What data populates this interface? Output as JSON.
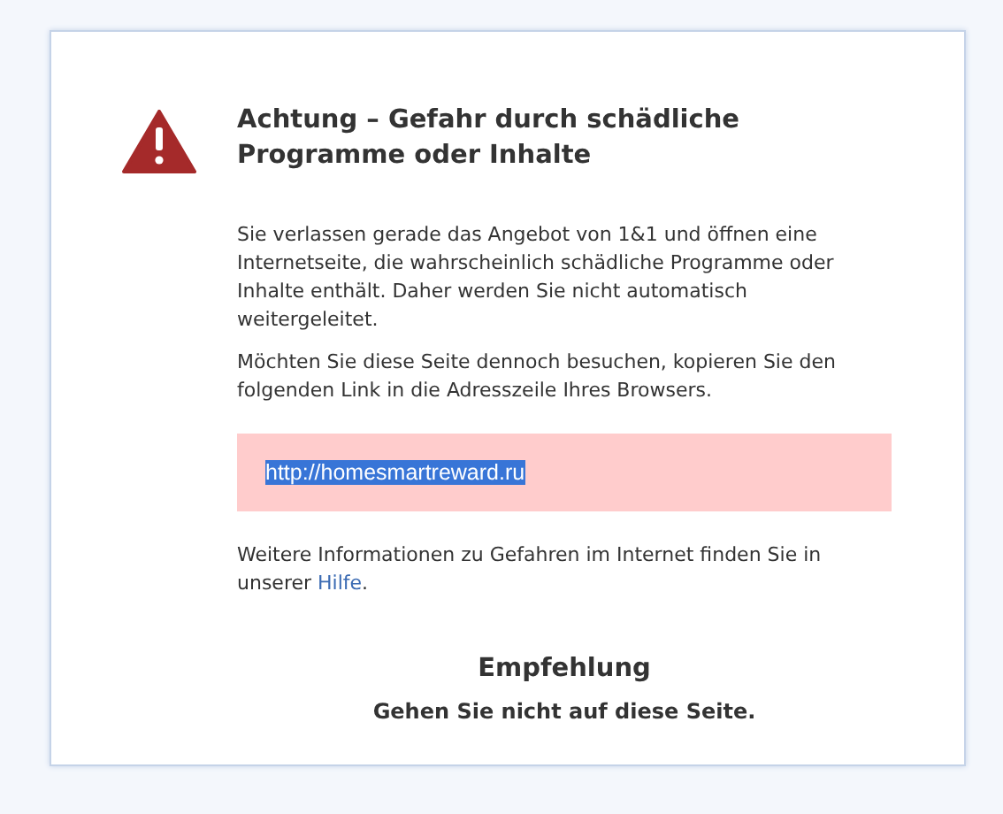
{
  "warning": {
    "title": "Achtung – Gefahr durch schädliche Programme oder Inhalte",
    "paragraphs": [
      "Sie verlassen gerade das Angebot von 1&1 und öffnen eine Internetseite, die wahrscheinlich schädliche Programme oder Inhalte enthält. Daher werden Sie nicht automatisch weitergeleitet.",
      "Möchten Sie diese Seite dennoch besuchen, kopieren Sie den folgenden Link in die Adresszeile Ihres Browsers."
    ],
    "url": {
      "text": "http://homesmartreward.ru",
      "selected": true
    },
    "info": {
      "text": "Weitere Informationen zu Gefahren im Internet finden Sie in unserer",
      "link": "Hilfe",
      "after": "."
    },
    "recommendation": {
      "heading": "Empfehlung",
      "text": "Gehen Sie nicht auf diese Seite."
    }
  }
}
